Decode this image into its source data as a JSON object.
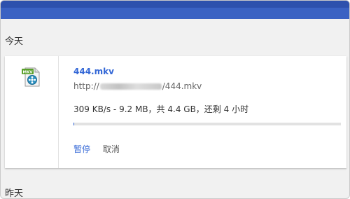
{
  "sections": {
    "today": "今天",
    "yesterday": "昨天"
  },
  "download": {
    "filename": "444.mkv",
    "url_prefix": "http://",
    "url_suffix": "/444.mkv",
    "status": "309 KB/s - 9.2 MB，共 4.4 GB，还剩 4 小时",
    "progress": 0.002,
    "icon": "mkv-video-file-icon",
    "icon_badge": "MKV",
    "actions": {
      "pause": "暂停",
      "cancel": "取消"
    }
  },
  "colors": {
    "header": "#3a62c3",
    "link": "#3367d6"
  }
}
